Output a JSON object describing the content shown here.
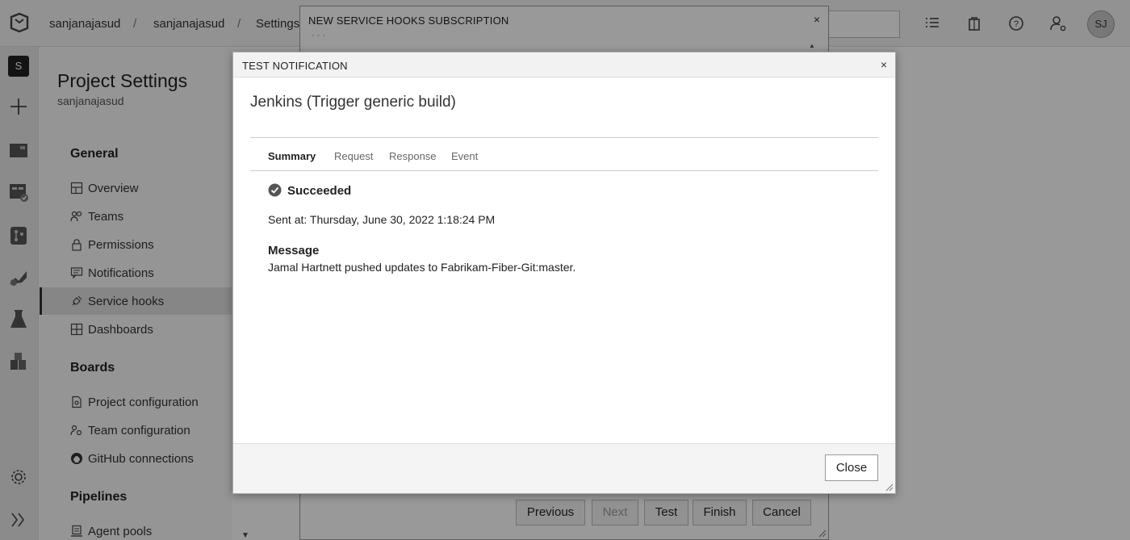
{
  "topbar": {
    "breadcrumbs": [
      "sanjanajasud",
      "sanjanajasud",
      "Settings"
    ],
    "separator": "/",
    "avatar_initials": "SJ",
    "icons": [
      "azure-devops-logo-icon",
      "list-icon",
      "shopping-bag-icon",
      "help-icon",
      "user-settings-icon"
    ]
  },
  "rail": {
    "project_initial": "S",
    "icons": [
      "add-icon",
      "overview-icon",
      "boards-icon",
      "repos-icon",
      "pipelines-icon",
      "test-plans-icon",
      "artifacts-icon",
      "settings-icon",
      "expand-icon"
    ]
  },
  "settings_panel": {
    "title": "Project Settings",
    "subtitle": "sanjanajasud",
    "sections": {
      "general": "General",
      "boards": "Boards",
      "pipelines": "Pipelines"
    },
    "general_items": [
      "Overview",
      "Teams",
      "Permissions",
      "Notifications",
      "Service hooks",
      "Dashboards"
    ],
    "boards_items": [
      "Project configuration",
      "Team configuration",
      "GitHub connections"
    ],
    "pipelines_items": [
      "Agent pools"
    ],
    "selected": "Service hooks"
  },
  "bg_dialog": {
    "title": "NEW SERVICE HOOKS SUBSCRIPTION",
    "close": "×",
    "dots": "· · ·",
    "buttons": {
      "previous": "Previous",
      "next": "Next",
      "test": "Test",
      "finish": "Finish",
      "cancel": "Cancel"
    }
  },
  "test_dialog": {
    "title": "TEST NOTIFICATION",
    "close": "×",
    "heading": "Jenkins (Trigger generic build)",
    "tabs": [
      "Summary",
      "Request",
      "Response",
      "Event"
    ],
    "active_tab": "Summary",
    "status": "Succeeded",
    "sent_at": "Sent at: Thursday, June 30, 2022 1:18:24 PM",
    "message_label": "Message",
    "message_body": "Jamal Hartnett pushed updates to Fabrikam-Fiber-Git:master.",
    "close_button": "Close"
  }
}
